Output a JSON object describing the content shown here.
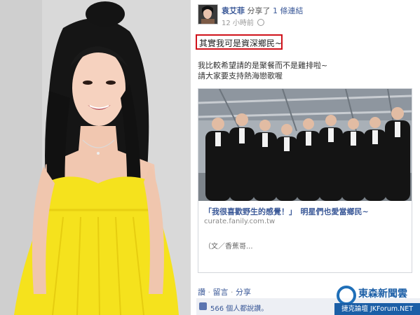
{
  "post": {
    "author": "袁艾菲",
    "action": "分享了",
    "link_text": "1 條連結",
    "time": "12 小時前",
    "highlight": "其實我可是資深鄉民~",
    "message_lines": [
      "我比較希望請的是聚餐而不是雞排啦~",
      "請大家要支持熱海戀歌喔"
    ]
  },
  "card": {
    "title": "「我很喜歡野生的感覺！」　明星們也愛當鄉民~",
    "url": "curate.fanily.com.tw",
    "description": "（文／香蕉哥..."
  },
  "actions": {
    "like": "讚",
    "comment": "留言",
    "share": "分享"
  },
  "likes": {
    "text": "566 個人都說讚。"
  },
  "watermark": {
    "name": "東森新聞雲",
    "subtitle": "捷克論壇 JKForum.NET"
  },
  "colors": {
    "facebook_blue": "#3b5998",
    "highlight_border": "#d0121b",
    "dress_yellow": "#f5e21d"
  }
}
